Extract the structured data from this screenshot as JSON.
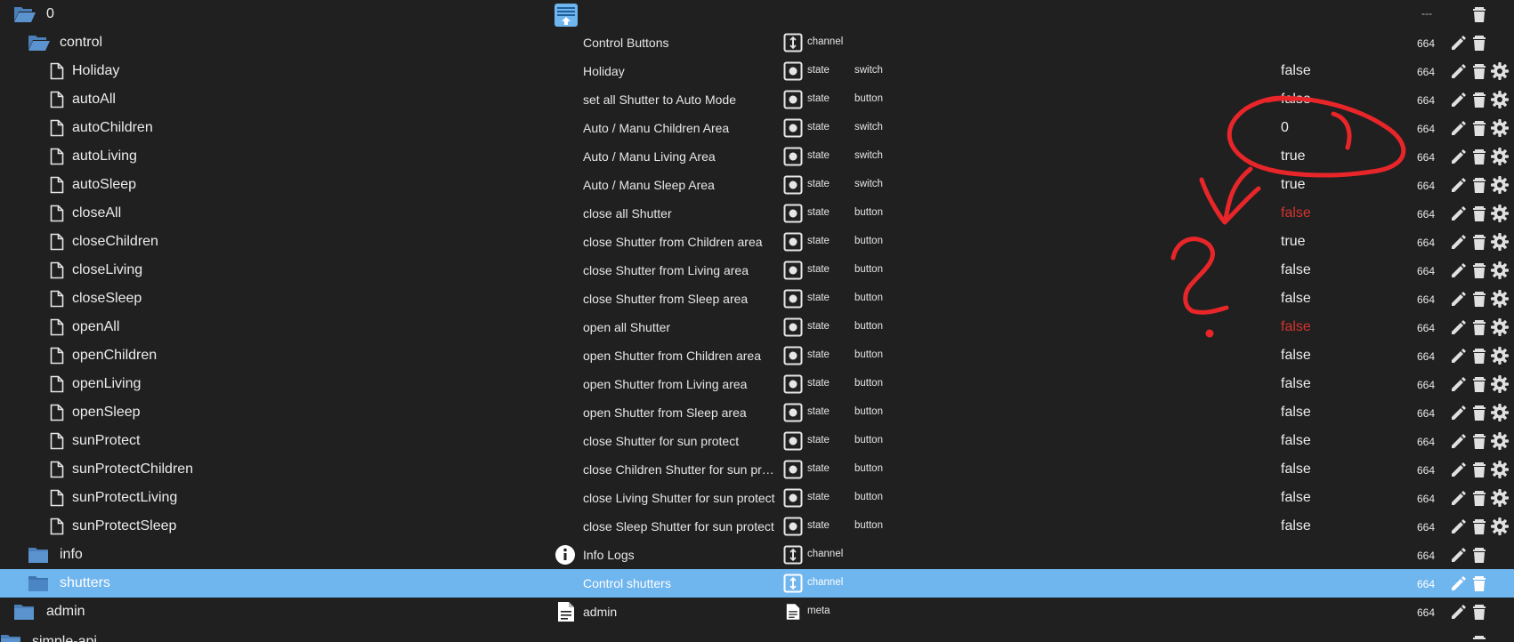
{
  "tree": {
    "root": {
      "name": "0",
      "acl": "---"
    },
    "control": {
      "name": "control",
      "desc": "Control Buttons",
      "type": "channel",
      "acl": "664"
    },
    "states": [
      {
        "name": "Holiday",
        "desc": "Holiday",
        "type": "state",
        "role": "switch",
        "value": "false",
        "acl": "664"
      },
      {
        "name": "autoAll",
        "desc": "set all Shutter to Auto Mode",
        "type": "state",
        "role": "button",
        "value": "false",
        "acl": "664"
      },
      {
        "name": "autoChildren",
        "desc": "Auto / Manu Children Area",
        "type": "state",
        "role": "switch",
        "value": "0",
        "acl": "664"
      },
      {
        "name": "autoLiving",
        "desc": "Auto / Manu Living Area",
        "type": "state",
        "role": "switch",
        "value": "true",
        "acl": "664"
      },
      {
        "name": "autoSleep",
        "desc": "Auto / Manu Sleep Area",
        "type": "state",
        "role": "switch",
        "value": "true",
        "acl": "664"
      },
      {
        "name": "closeAll",
        "desc": "close all Shutter",
        "type": "state",
        "role": "button",
        "value": "false",
        "acl": "664",
        "red": true
      },
      {
        "name": "closeChildren",
        "desc": "close Shutter from Children area",
        "type": "state",
        "role": "button",
        "value": "true",
        "acl": "664"
      },
      {
        "name": "closeLiving",
        "desc": "close Shutter from Living area",
        "type": "state",
        "role": "button",
        "value": "false",
        "acl": "664"
      },
      {
        "name": "closeSleep",
        "desc": "close Shutter from Sleep area",
        "type": "state",
        "role": "button",
        "value": "false",
        "acl": "664"
      },
      {
        "name": "openAll",
        "desc": "open all Shutter",
        "type": "state",
        "role": "button",
        "value": "false",
        "acl": "664",
        "red": true
      },
      {
        "name": "openChildren",
        "desc": "open Shutter from Children area",
        "type": "state",
        "role": "button",
        "value": "false",
        "acl": "664"
      },
      {
        "name": "openLiving",
        "desc": "open Shutter from Living area",
        "type": "state",
        "role": "button",
        "value": "false",
        "acl": "664"
      },
      {
        "name": "openSleep",
        "desc": "open Shutter from Sleep area",
        "type": "state",
        "role": "button",
        "value": "false",
        "acl": "664"
      },
      {
        "name": "sunProtect",
        "desc": "close Shutter for sun protect",
        "type": "state",
        "role": "button",
        "value": "false",
        "acl": "664"
      },
      {
        "name": "sunProtectChildren",
        "desc": "close Children Shutter for sun prot...",
        "type": "state",
        "role": "button",
        "value": "false",
        "acl": "664"
      },
      {
        "name": "sunProtectLiving",
        "desc": "close Living Shutter for sun protect",
        "type": "state",
        "role": "button",
        "value": "false",
        "acl": "664"
      },
      {
        "name": "sunProtectSleep",
        "desc": "close Sleep Shutter for sun protect",
        "type": "state",
        "role": "button",
        "value": "false",
        "acl": "664"
      }
    ],
    "info": {
      "name": "info",
      "desc": "Info Logs",
      "type": "channel",
      "acl": "664"
    },
    "shutters": {
      "name": "shutters",
      "desc": "Control shutters",
      "type": "channel",
      "acl": "664"
    },
    "admin": {
      "name": "admin",
      "desc": "admin",
      "type": "meta",
      "acl": "664"
    },
    "next": {
      "name": "simple-api"
    }
  },
  "colors": {
    "background": "#202020",
    "selected_row": "#6fb5ee",
    "folder": "#4a7fb8",
    "value_red": "#d3332e",
    "annotation": "#e8262a"
  },
  "icons": [
    "folder-open-icon",
    "folder-icon",
    "file-icon",
    "channel-icon",
    "state-icon",
    "info-icon",
    "document-icon",
    "pencil-icon",
    "trash-icon",
    "gear-icon",
    "adapter-logo-icon"
  ]
}
